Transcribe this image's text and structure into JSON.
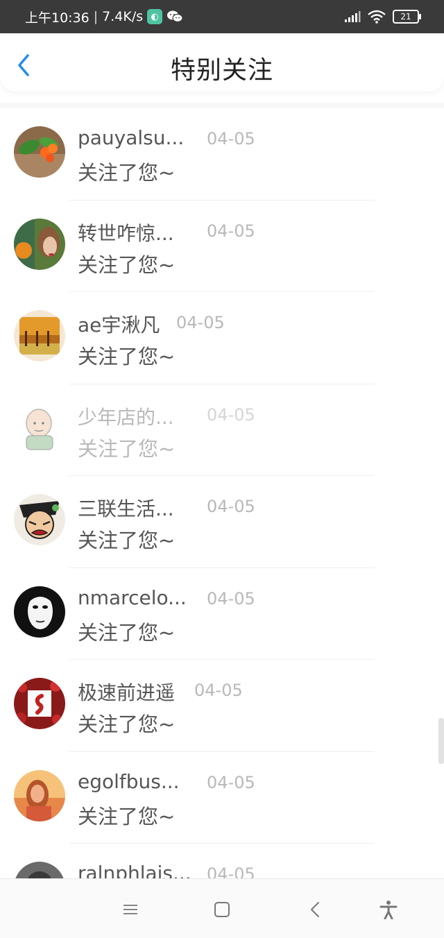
{
  "status_bar": {
    "time": "上午10:36",
    "speed": "7.4K/s",
    "battery": "21",
    "icons": [
      "app-notification-icon",
      "wechat-icon",
      "signal-icon",
      "wifi-icon",
      "battery-icon"
    ]
  },
  "header": {
    "title": "特别关注",
    "back_icon": "back-chevron-icon"
  },
  "colors": {
    "accent": "#1f8ff0",
    "status_bar_bg": "#3a3a3a",
    "text_primary": "#555555",
    "text_secondary": "#b8b8b8"
  },
  "list": [
    {
      "name": "pauyalsu...",
      "date": "04-05",
      "message": "关注了您~",
      "avatar": "orange-flower-avatar"
    },
    {
      "name": "转世咋惊...",
      "date": "04-05",
      "message": "关注了您~",
      "avatar": "woman-autumn-avatar"
    },
    {
      "name": "ae宇湫凡",
      "date": "04-05",
      "message": "关注了您~",
      "avatar": "autumn-trees-avatar"
    },
    {
      "name": "少年店的...",
      "date": "04-05",
      "message": "关注了您~",
      "avatar": "cartoon-bald-avatar"
    },
    {
      "name": "三联生活...",
      "date": "04-05",
      "message": "关注了您~",
      "avatar": "cartoon-face-avatar"
    },
    {
      "name": "nmarcelo...",
      "date": "04-05",
      "message": "关注了您~",
      "avatar": "mask-face-avatar"
    },
    {
      "name": "极速前进遥",
      "date": "04-05",
      "message": "关注了您~",
      "avatar": "red-roses-avatar"
    },
    {
      "name": "egolfbus...",
      "date": "04-05",
      "message": "关注了您~",
      "avatar": "girl-sunset-avatar"
    },
    {
      "name": "ralnphlais...",
      "date": "04-05",
      "message": "",
      "avatar": "dark-avatar"
    }
  ],
  "nav": {
    "icons": [
      "menu-icon",
      "home-square-icon",
      "back-triangle-icon",
      "accessibility-icon"
    ]
  }
}
